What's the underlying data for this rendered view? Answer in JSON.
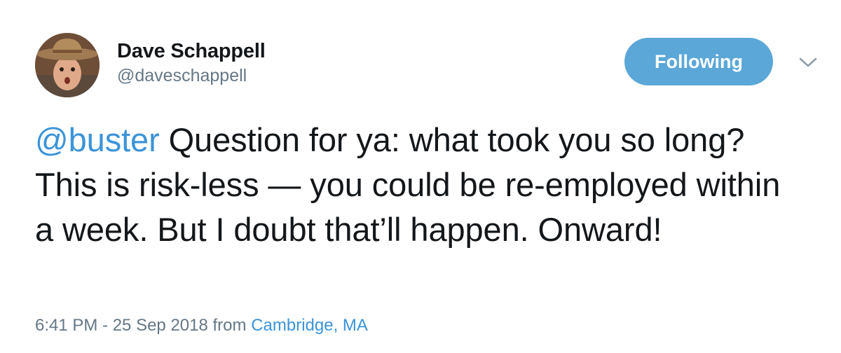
{
  "author": {
    "display_name": "Dave Schappell",
    "handle": "@daveschappell"
  },
  "follow_button": {
    "label": "Following"
  },
  "caret": {
    "icon": "chevron-down-icon"
  },
  "tweet": {
    "mention": "@buster",
    "text": " Question for ya: what took you so long? This is risk-less — you could be re-employed within a week. But I doubt that’ll happen. Onward!"
  },
  "meta": {
    "time_date": "6:41 PM - 25 Sep 2018",
    "from_label": " from ",
    "location": "Cambridge, MA"
  },
  "colors": {
    "follow_button": "#5aa7d8",
    "link": "#3b94d9",
    "secondary_text": "#657786",
    "primary_text": "#14171a"
  }
}
